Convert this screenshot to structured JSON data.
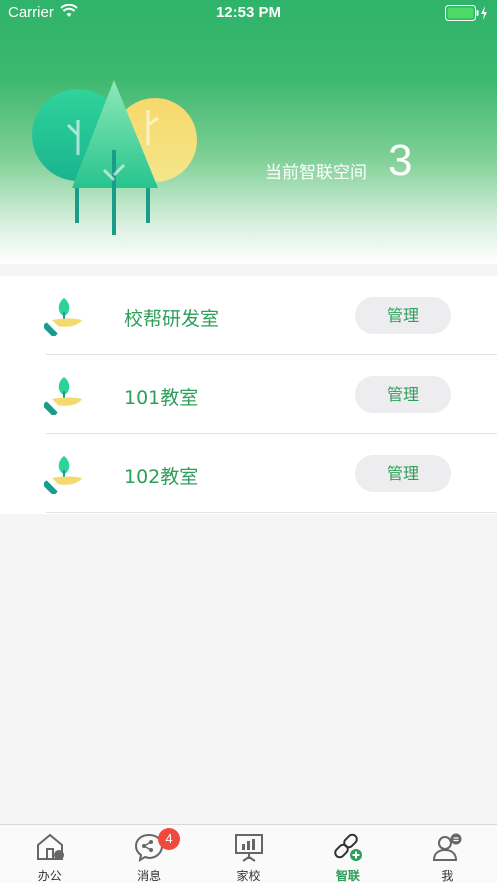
{
  "status_bar": {
    "carrier": "Carrier",
    "time": "12:53 PM"
  },
  "header": {
    "space_label": "当前智联空间",
    "space_count": "3"
  },
  "spaces": [
    {
      "name": "校帮研发室",
      "action": "管理"
    },
    {
      "name": "101教室",
      "action": "管理"
    },
    {
      "name": "102教室",
      "action": "管理"
    }
  ],
  "tabbar": {
    "items": [
      {
        "label": "办公",
        "icon": "office-icon"
      },
      {
        "label": "消息",
        "icon": "message-icon",
        "badge": "4"
      },
      {
        "label": "家校",
        "icon": "presentation-icon"
      },
      {
        "label": "智联",
        "icon": "link-icon",
        "active": true
      },
      {
        "label": "我",
        "icon": "profile-icon"
      }
    ]
  },
  "colors": {
    "accent": "#2e9e5a",
    "header_green": "#2fb36a",
    "badge": "#f0493e"
  }
}
